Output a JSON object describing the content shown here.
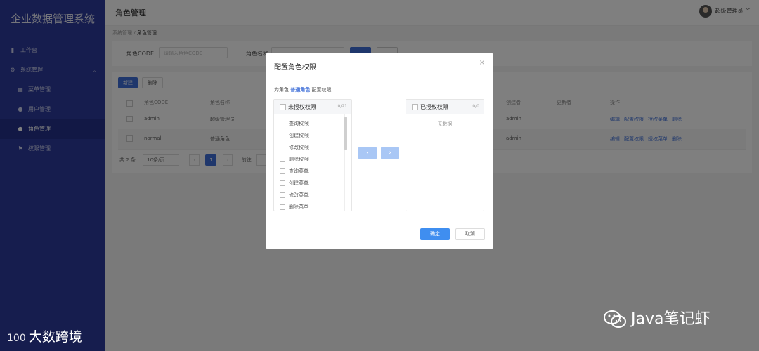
{
  "app": {
    "title": "企业数据管理系统",
    "page_title": "角色管理"
  },
  "sidebar": {
    "items": [
      {
        "label": "工作台",
        "icon": "bar-chart-icon"
      },
      {
        "label": "系统管理",
        "icon": "gear-icon"
      },
      {
        "label": "菜单管理",
        "icon": "grid-icon"
      },
      {
        "label": "用户管理",
        "icon": "user-icon"
      },
      {
        "label": "角色管理",
        "icon": "user-icon"
      },
      {
        "label": "权限管理",
        "icon": "flag-icon"
      }
    ]
  },
  "user": {
    "name": "超级管理员"
  },
  "breadcrumb": {
    "parent": "系统管理",
    "sep": "/",
    "current": "角色管理"
  },
  "search": {
    "code_label": "角色CODE",
    "code_placeholder": "请输入角色CODE",
    "name_label": "角色名称"
  },
  "toolbar": {
    "new_label": "新建",
    "delete_label": "删除"
  },
  "table": {
    "headers": [
      "角色CODE",
      "角色名称",
      "创建者",
      "更新者",
      "操作"
    ],
    "rows": [
      {
        "code": "admin",
        "name": "超级管理员",
        "creator": "admin"
      },
      {
        "code": "normal",
        "name": "普通角色",
        "creator": "admin"
      }
    ],
    "ops": [
      "编辑",
      "配置权限",
      "授权菜单",
      "删除"
    ]
  },
  "pager": {
    "total": "共 2 条",
    "page_size": "10条/页",
    "prev": "‹",
    "current": "1",
    "next": "›",
    "goto": "前往"
  },
  "dialog": {
    "title": "配置角色权限",
    "close": "×",
    "desc_prefix": "为角色",
    "role": "普通角色",
    "desc_suffix": "配置权限",
    "left": {
      "title": "未授权权限",
      "count": "0/21",
      "items": [
        "查询权限",
        "创建权限",
        "修改权限",
        "删除权限",
        "查询菜单",
        "创建菜单",
        "修改菜单",
        "删除菜单"
      ]
    },
    "right": {
      "title": "已授权权限",
      "count": "0/0",
      "empty": "无数据"
    },
    "to_left": "‹",
    "to_right": "›",
    "ok": "确定",
    "cancel": "取消"
  },
  "watermarks": {
    "logo": "大数跨境",
    "logo_mark": "100",
    "wechat": "Java笔记虾"
  }
}
